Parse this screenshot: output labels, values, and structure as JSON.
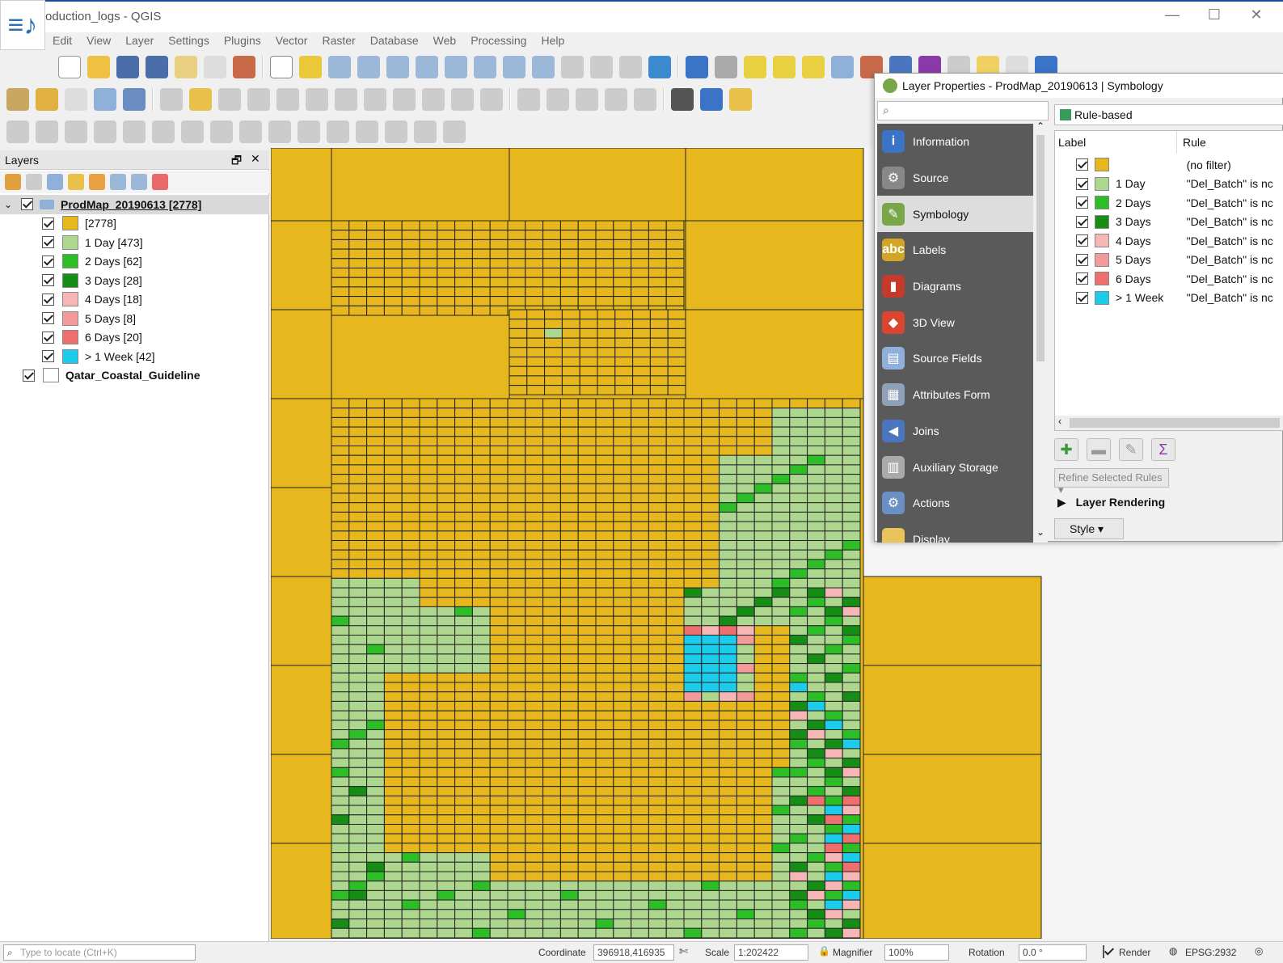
{
  "window": {
    "title": "oduction_logs - QGIS",
    "minimize": "—",
    "maximize": "☐",
    "close": "✕"
  },
  "menu": [
    "Edit",
    "View",
    "Layer",
    "Settings",
    "Plugins",
    "Vector",
    "Raster",
    "Database",
    "Web",
    "Processing",
    "Help"
  ],
  "layers_panel": {
    "title": "Layers",
    "float_icon": "🗗",
    "close_icon": "✕",
    "group_name": "ProdMap_20190613 [2778]",
    "items": [
      {
        "label": "[2778]",
        "color": "#E6B81E"
      },
      {
        "label": "1 Day [473]",
        "color": "#ADD68F"
      },
      {
        "label": "2 Days [62]",
        "color": "#2DBE27"
      },
      {
        "label": "3 Days [28]",
        "color": "#168E16"
      },
      {
        "label": "4 Days [18]",
        "color": "#F6B6B6"
      },
      {
        "label": "5 Days [8]",
        "color": "#F39A9A"
      },
      {
        "label": "6 Days [20]",
        "color": "#EF6E6E"
      },
      {
        "label": "> 1 Week [42]",
        "color": "#1BCDEB"
      }
    ],
    "second_layer": "Qatar_Coastal_Guideline"
  },
  "layer_properties": {
    "title": "Layer Properties - ProdMap_20190613 | Symbology",
    "renderer": "Rule-based",
    "sidebar": [
      {
        "label": "Information",
        "icon": "info-icon",
        "color": "#3b73c6",
        "glyph": "i"
      },
      {
        "label": "Source",
        "icon": "wrench-icon",
        "color": "#888",
        "glyph": "⚙"
      },
      {
        "label": "Symbology",
        "icon": "paintbrush-icon",
        "color": "#7aa64a",
        "glyph": "✎"
      },
      {
        "label": "Labels",
        "icon": "abc-icon",
        "color": "#d2a526",
        "glyph": "abc"
      },
      {
        "label": "Diagrams",
        "icon": "diagram-icon",
        "color": "#c53a2a",
        "glyph": "▮"
      },
      {
        "label": "3D View",
        "icon": "cube-icon",
        "color": "#d9452e",
        "glyph": "◆"
      },
      {
        "label": "Source Fields",
        "icon": "fields-icon",
        "color": "#8fb0d8",
        "glyph": "▤"
      },
      {
        "label": "Attributes Form",
        "icon": "form-icon",
        "color": "#8fa0b8",
        "glyph": "▦"
      },
      {
        "label": "Joins",
        "icon": "joins-icon",
        "color": "#4a76c0",
        "glyph": "◀"
      },
      {
        "label": "Auxiliary Storage",
        "icon": "storage-icon",
        "color": "#aaa",
        "glyph": "▥"
      },
      {
        "label": "Actions",
        "icon": "actions-icon",
        "color": "#6b8fc4",
        "glyph": "⚙"
      },
      {
        "label": "Display",
        "icon": "display-icon",
        "color": "#e8c45a",
        "glyph": ""
      }
    ],
    "active_index": 2,
    "rules_header": {
      "label": "Label",
      "rule": "Rule"
    },
    "rules": [
      {
        "label": "",
        "rule": "(no filter)",
        "color": "#E6B81E"
      },
      {
        "label": "1 Day",
        "rule": "\"Del_Batch\" is nc",
        "color": "#ADD68F"
      },
      {
        "label": "2 Days",
        "rule": "\"Del_Batch\" is nc",
        "color": "#2DBE27"
      },
      {
        "label": "3 Days",
        "rule": "\"Del_Batch\" is nc",
        "color": "#168E16"
      },
      {
        "label": "4 Days",
        "rule": "\"Del_Batch\" is nc",
        "color": "#F6B6B6"
      },
      {
        "label": "5 Days",
        "rule": "\"Del_Batch\" is nc",
        "color": "#F39A9A"
      },
      {
        "label": "6 Days",
        "rule": "\"Del_Batch\" is nc",
        "color": "#EF6E6E"
      },
      {
        "label": "> 1 Week",
        "rule": "\"Del_Batch\" is nc",
        "color": "#1BCDEB"
      }
    ],
    "refine_button": "Refine Selected Rules",
    "layer_rendering": "Layer Rendering",
    "style_button": "Style"
  },
  "statusbar": {
    "locate_placeholder": "Type to locate (Ctrl+K)",
    "coordinate_label": "Coordinate",
    "coordinate_value": "396918,416935",
    "scale_label": "Scale",
    "scale_value": "1:202422",
    "magnifier_label": "Magnifier",
    "magnifier_value": "100%",
    "rotation_label": "Rotation",
    "rotation_value": "0.0 °",
    "render_label": "Render",
    "crs_label": "EPSG:2932"
  }
}
